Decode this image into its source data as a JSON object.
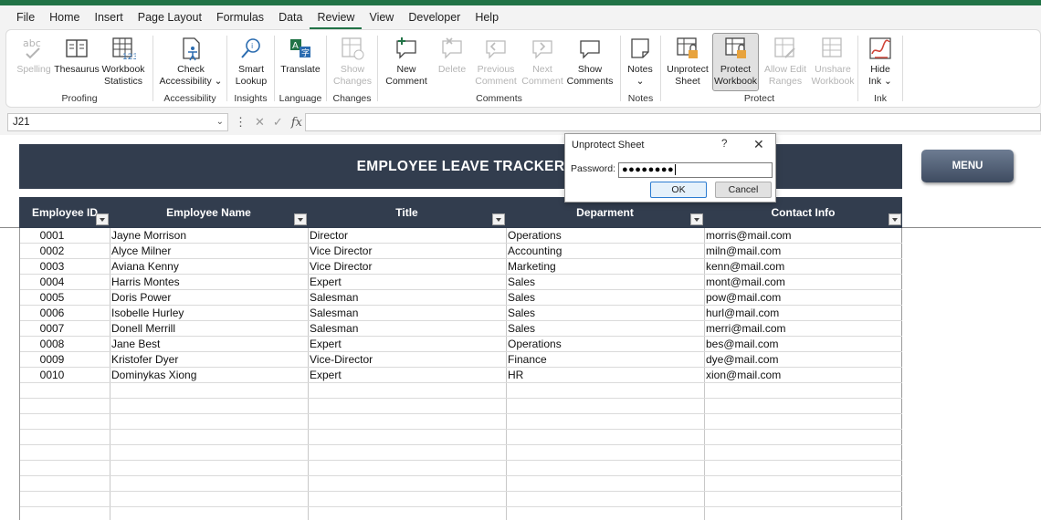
{
  "menu": {
    "tabs": [
      "File",
      "Home",
      "Insert",
      "Page Layout",
      "Formulas",
      "Data",
      "Review",
      "View",
      "Developer",
      "Help"
    ],
    "active": "Review"
  },
  "ribbon": {
    "proofing": {
      "label": "Proofing",
      "spelling": "Spelling",
      "thesaurus": "Thesaurus",
      "workbook_stats_1": "Workbook",
      "workbook_stats_2": "Statistics"
    },
    "accessibility": {
      "label": "Accessibility",
      "check_1": "Check",
      "check_2": "Accessibility ⌄"
    },
    "insights": {
      "label": "Insights",
      "smart_1": "Smart",
      "smart_2": "Lookup"
    },
    "language": {
      "label": "Language",
      "translate": "Translate"
    },
    "changes": {
      "label": "Changes",
      "show_1": "Show",
      "show_2": "Changes"
    },
    "comments": {
      "label": "Comments",
      "new_1": "New",
      "new_2": "Comment",
      "delete": "Delete",
      "prev_1": "Previous",
      "prev_2": "Comment",
      "next_1": "Next",
      "next_2": "Comment",
      "show_1": "Show",
      "show_2": "Comments"
    },
    "notes": {
      "label": "Notes",
      "notes": "Notes",
      "notes_drop": "⌄"
    },
    "protect": {
      "label": "Protect",
      "unprotect_1": "Unprotect",
      "unprotect_2": "Sheet",
      "protect_1": "Protect",
      "protect_2": "Workbook",
      "allow_1": "Allow Edit",
      "allow_2": "Ranges",
      "unshare_1": "Unshare",
      "unshare_2": "Workbook"
    },
    "ink": {
      "label": "Ink",
      "hide_1": "Hide",
      "hide_2": "Ink ⌄"
    }
  },
  "formula_bar": {
    "name_box": "J21",
    "fx": "fx",
    "content": ""
  },
  "sheet": {
    "title": "EMPLOYEE LEAVE TRACKER",
    "menu_button": "MENU",
    "columns": [
      "Employee ID",
      "Employee Name",
      "Title",
      "Deparment",
      "Contact Info"
    ],
    "rows": [
      [
        "0001",
        "Jayne Morrison",
        "Director",
        "Operations",
        "morris@mail.com"
      ],
      [
        "0002",
        "Alyce Milner",
        "Vice Director",
        "Accounting",
        "miln@mail.com"
      ],
      [
        "0003",
        "Aviana Kenny",
        "Vice Director",
        "Marketing",
        "kenn@mail.com"
      ],
      [
        "0004",
        "Harris Montes",
        "Expert",
        "Sales",
        "mont@mail.com"
      ],
      [
        "0005",
        "Doris Power",
        "Salesman",
        "Sales",
        "pow@mail.com"
      ],
      [
        "0006",
        "Isobelle Hurley",
        "Salesman",
        "Sales",
        "hurl@mail.com"
      ],
      [
        "0007",
        "Donell Merrill",
        "Salesman",
        "Sales",
        "merri@mail.com"
      ],
      [
        "0008",
        "Jane Best",
        "Expert",
        "Operations",
        "bes@mail.com"
      ],
      [
        "0009",
        "Kristofer Dyer",
        "Vice-Director",
        "Finance",
        "dye@mail.com"
      ],
      [
        "0010",
        "Dominykas Xiong",
        "Expert",
        "HR",
        "xion@mail.com"
      ]
    ]
  },
  "dialog": {
    "title": "Unprotect Sheet",
    "help": "?",
    "close": "✕",
    "password_label": "Password:",
    "password_value": "●●●●●●●●",
    "ok": "OK",
    "cancel": "Cancel"
  },
  "colors": {
    "excel_green": "#217346",
    "header_navy": "#323d4e",
    "menu_button": "#4f5d73"
  }
}
